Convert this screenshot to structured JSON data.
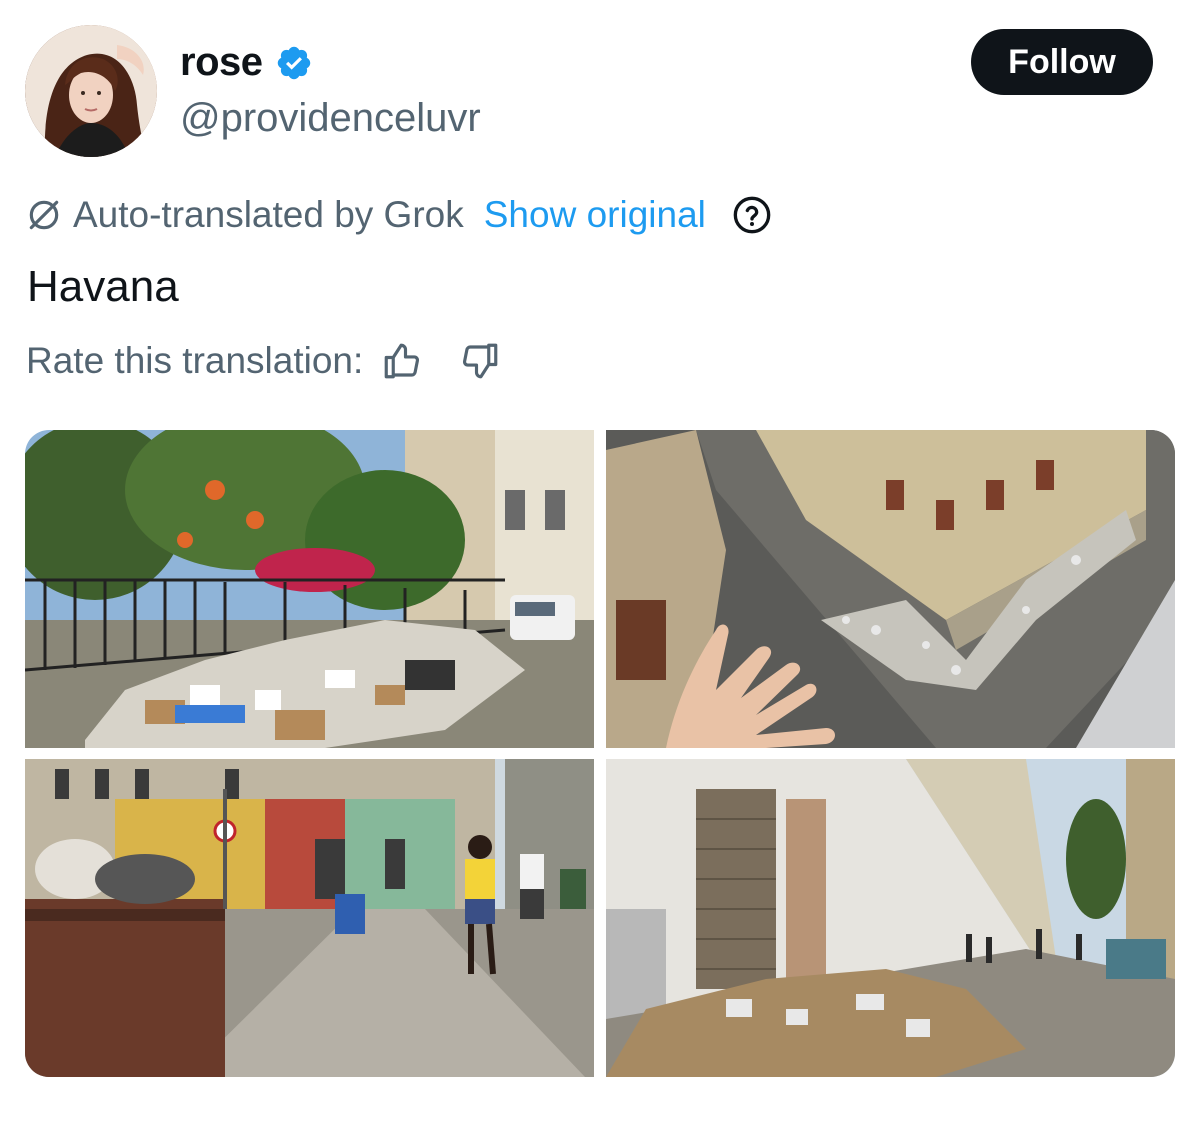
{
  "author": {
    "display_name": "rose",
    "handle": "@providenceluvr",
    "verified": true,
    "avatar_icon": "profile-photo"
  },
  "follow_button": {
    "label": "Follow"
  },
  "translation": {
    "note": "Auto-translated by Grok",
    "show_original": "Show original",
    "help_icon": "question-circle-icon"
  },
  "tweet": {
    "text": "Havana"
  },
  "rating": {
    "label": "Rate this translation:",
    "up_icon": "thumbs-up-icon",
    "down_icon": "thumbs-down-icon"
  },
  "media": {
    "count": 4,
    "photos": [
      {
        "id": "photo-1",
        "subject": "garbage-pile-by-fence"
      },
      {
        "id": "photo-2",
        "subject": "aerial-street-with-hand"
      },
      {
        "id": "photo-3",
        "subject": "street-with-dumpsters"
      },
      {
        "id": "photo-4",
        "subject": "alley-with-debris"
      }
    ]
  },
  "colors": {
    "text_primary": "#0f1419",
    "text_secondary": "#536471",
    "link": "#1d9bf0",
    "verified_badge": "#1d9bf0",
    "follow_bg": "#0f1419"
  }
}
